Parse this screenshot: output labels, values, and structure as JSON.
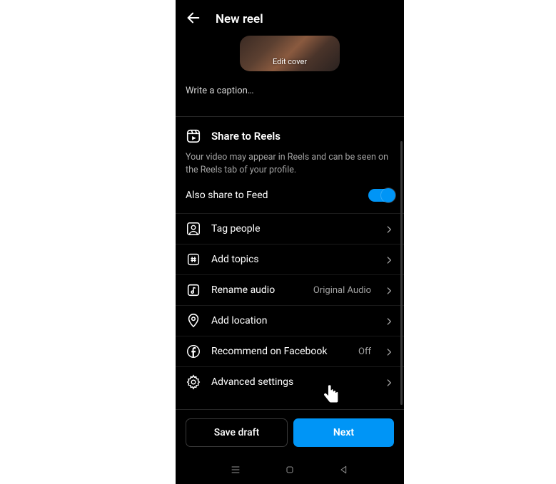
{
  "header": {
    "title": "New reel"
  },
  "cover": {
    "edit_label": "Edit cover"
  },
  "caption": {
    "placeholder": "Write a caption…"
  },
  "share": {
    "title": "Share to Reels",
    "description": "Your video may appear in Reels and can be seen on the Reels tab of your profile.",
    "also_label": "Also share to Feed"
  },
  "rows": {
    "tag_people": "Tag people",
    "add_topics": "Add topics",
    "rename_audio": "Rename audio",
    "rename_audio_value": "Original Audio",
    "add_location": "Add location",
    "recommend_fb": "Recommend on Facebook",
    "recommend_fb_value": "Off",
    "advanced": "Advanced settings"
  },
  "buttons": {
    "save_draft": "Save draft",
    "next": "Next"
  }
}
